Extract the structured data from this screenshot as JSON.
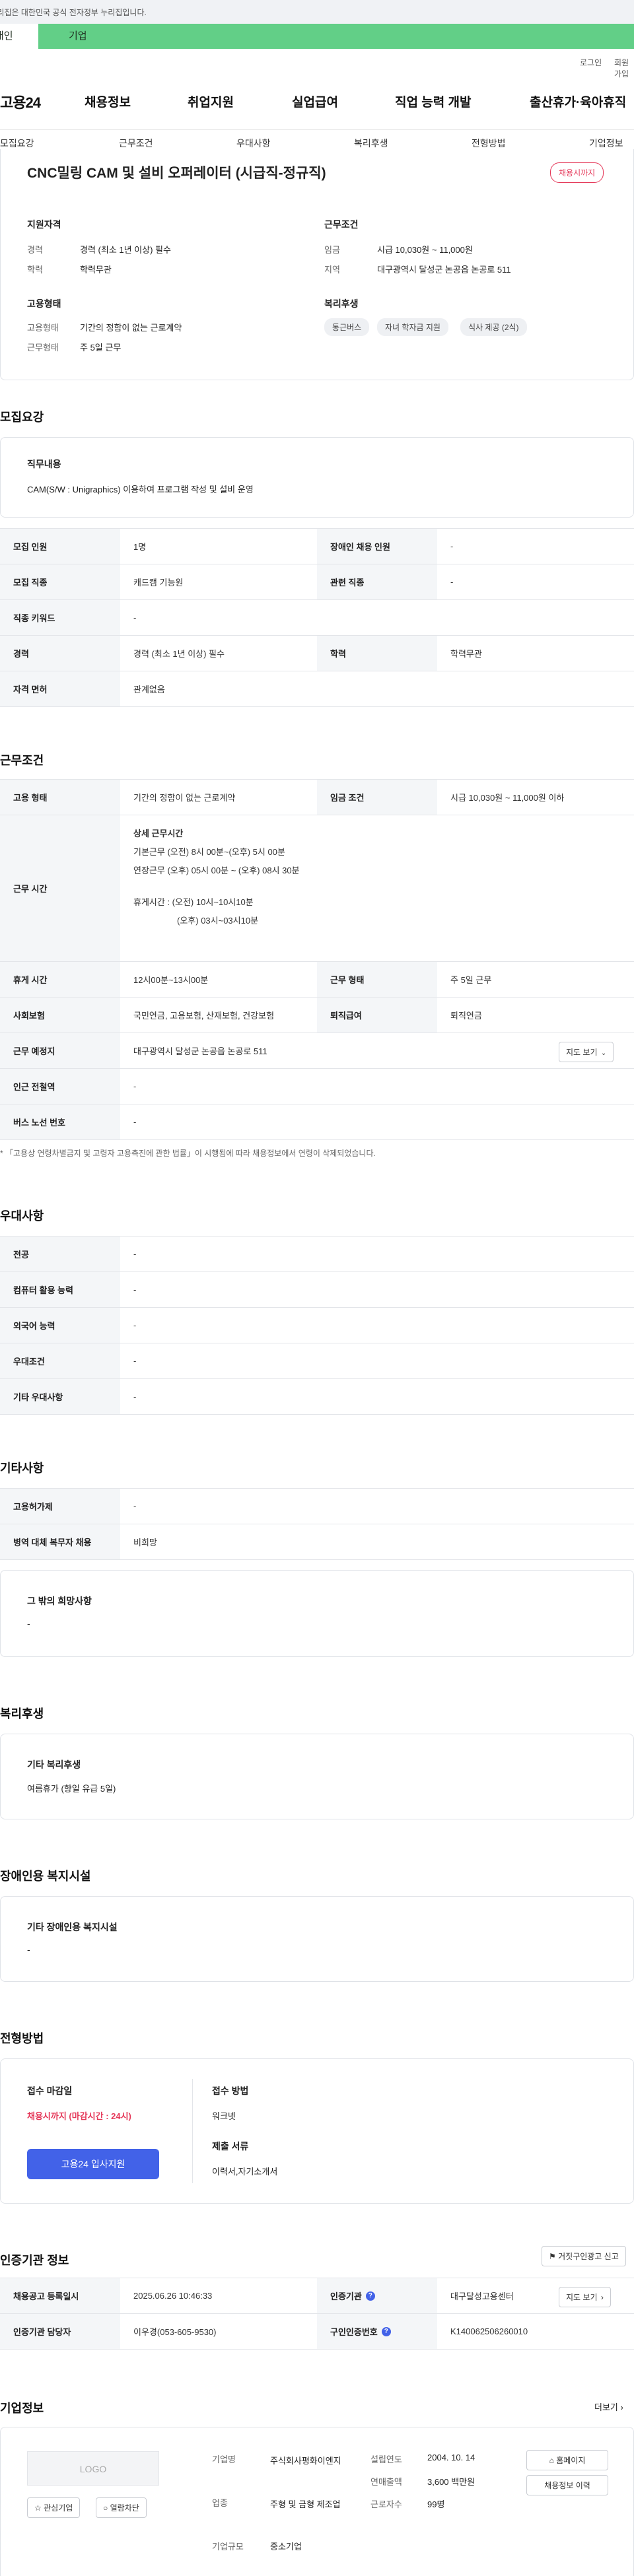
{
  "gov_banner": "이 누리집은 대한민국 공식 전자정부 누리집입니다.",
  "audience_tabs": {
    "personal": "개인",
    "company": "기업"
  },
  "utility": {
    "login": "로그인",
    "signup": "회원가입"
  },
  "gnb": {
    "logo": "고용24",
    "menus": [
      "채용정보",
      "취업지원",
      "실업급여",
      "직업 능력 개발",
      "출산휴가·육아휴직"
    ]
  },
  "subnav": [
    "모집요강",
    "근무조건",
    "우대사항",
    "복리후생",
    "전형방법",
    "기업정보"
  ],
  "summary": {
    "title": "CNC밀링 CAM 및 설비 오퍼레이터 (시급직-정규직)",
    "status_badge": "채용시까지",
    "qualification_heading": "지원자격",
    "career_label": "경력",
    "career_value": "경력 (최소 1년 이상) 필수",
    "edu_label": "학력",
    "edu_value": "학력무관",
    "employment_heading": "고용형태",
    "emp_type_label": "고용형태",
    "emp_type_value": "기간의 정함이 없는 근로계약",
    "work_form_label": "근무형태",
    "work_form_value": "주 5일 근무",
    "conditions_heading": "근무조건",
    "wage_label": "임금",
    "wage_value": "시급 10,030원 ~ 11,000원",
    "region_label": "지역",
    "region_value": "대구광역시 달성군 논공읍 논공로 511",
    "welfare_heading": "복리후생",
    "welfare_chips": [
      "통근버스",
      "자녀 학자금 지원",
      "식사 제공 (2식)"
    ]
  },
  "recruit": {
    "heading": "모집요강",
    "job_content_label": "직무내용",
    "job_content_value": "CAM(S/W : Unigraphics) 이용하여 프로그램 작성 및 설비 운영",
    "rows": [
      {
        "th": "모집 인원",
        "td": "1명",
        "th2": "장애인 채용 인원",
        "td2": "-"
      },
      {
        "th": "모집 직종",
        "td": "캐드캠 기능원",
        "th2": "관련 직종",
        "td2": "-"
      },
      {
        "th": "직종 키워드",
        "td": "-",
        "th2": "",
        "td2": ""
      },
      {
        "th": "경력",
        "td": "경력 (최소 1년 이상) 필수",
        "th2": "학력",
        "td2": "학력무관"
      },
      {
        "th": "자격 면허",
        "td": "관계없음",
        "th2": "",
        "td2": ""
      }
    ]
  },
  "work": {
    "heading": "근무조건",
    "emp_type_th": "고용 형태",
    "emp_type_td": "기간의 정함이 없는 근로계약",
    "wage_th": "임금 조건",
    "wage_td": "시급 10,030원 ~ 11,000원 이하",
    "hours_th": "근무 시간",
    "hours_detail_title": "상세 근무시간",
    "hours_lines": [
      "기본근무 (오전) 8시 00분~(오후) 5시 00분",
      "연장근무 (오후) 05시 00분 ~ (오후) 08시 30분",
      "",
      "휴게시간 : (오전) 10시~10시10분",
      "(오후) 03시~03시10분"
    ],
    "break_th": "휴게 시간",
    "break_td": "12시00분~13시00분",
    "form_th": "근무 형태",
    "form_td": "주 5일 근무",
    "insurance_th": "사회보험",
    "insurance_td": "국민연금, 고용보험, 산재보험, 건강보험",
    "severance_th": "퇴직급여",
    "severance_td": "퇴직연금",
    "location_th": "근무 예정지",
    "location_td": "대구광역시 달성군 논공읍 논공로 511",
    "map_button": "지도 보기",
    "subway_th": "인근 전철역",
    "subway_td": "-",
    "bus_th": "버스 노선 번호",
    "bus_td": "-",
    "notice": "「고용상 연령차별금지 및 고령자 고용촉진에 관한 법률」이 시행됨에 따라 채용정보에서 연령이 삭제되었습니다."
  },
  "preference": {
    "heading": "우대사항",
    "rows": [
      {
        "th": "전공",
        "td": "-"
      },
      {
        "th": "컴퓨터 활용 능력",
        "td": "-"
      },
      {
        "th": "외국어 능력",
        "td": "-"
      },
      {
        "th": "우대조건",
        "td": "-"
      },
      {
        "th": "기타 우대사항",
        "td": "-"
      }
    ]
  },
  "etc": {
    "heading": "기타사항",
    "rows": [
      {
        "th": "고용허가제",
        "td": "-"
      },
      {
        "th": "병역 대체 복무자 채용",
        "td": "비희망"
      }
    ],
    "other_label": "그 밖의 희망사항",
    "other_value": "-"
  },
  "welfare": {
    "heading": "복리후생",
    "label": "기타 복리후생",
    "value": "여름휴가 (향일 유급 5일)"
  },
  "disability": {
    "heading": "장애인용 복지시설",
    "label": "기타 장애인용 복지시설",
    "value": "-"
  },
  "selection": {
    "heading": "전형방법",
    "deadline_label": "접수 마감일",
    "deadline_value": "채용시까지 (마감시간 : 24시)",
    "apply_button": "고용24 입사지원",
    "method_label": "접수 방법",
    "method_value": "워크넷",
    "docs_label": "제출 서류",
    "docs_value": "이력서,자기소개서"
  },
  "agency": {
    "heading": "인증기관 정보",
    "report_button": "거짓구인광고 신고",
    "reg_date_th": "채용공고 등록일시",
    "reg_date_td": "2025.06.26 10:46:33",
    "agency_th": "인증기관",
    "agency_td": "대구달성고용센터",
    "map_button": "지도 보기",
    "manager_th": "인증기관 담당자",
    "manager_td": "이우경(053-605-9530)",
    "cert_no_th": "구인인증번호",
    "cert_no_td": "K140062506260010"
  },
  "company": {
    "heading": "기업정보",
    "more": "더보기",
    "logo_placeholder": "LOGO",
    "interest_button": "관심기업",
    "block_button": "열람차단",
    "name_label": "기업명",
    "name_value": "주식회사평화이엔지",
    "industry_label": "업종",
    "industry_value": "주형 및 금형 제조업",
    "size_label": "기업규모",
    "size_value": "중소기업",
    "founded_label": "설립연도",
    "founded_value": "2004. 10. 14",
    "sales_label": "연매출액",
    "sales_value": "3,600 백만원",
    "employees_label": "근로자수",
    "employees_value": "99명",
    "homepage_button": "홈페이지",
    "history_button": "채용정보 이력"
  }
}
